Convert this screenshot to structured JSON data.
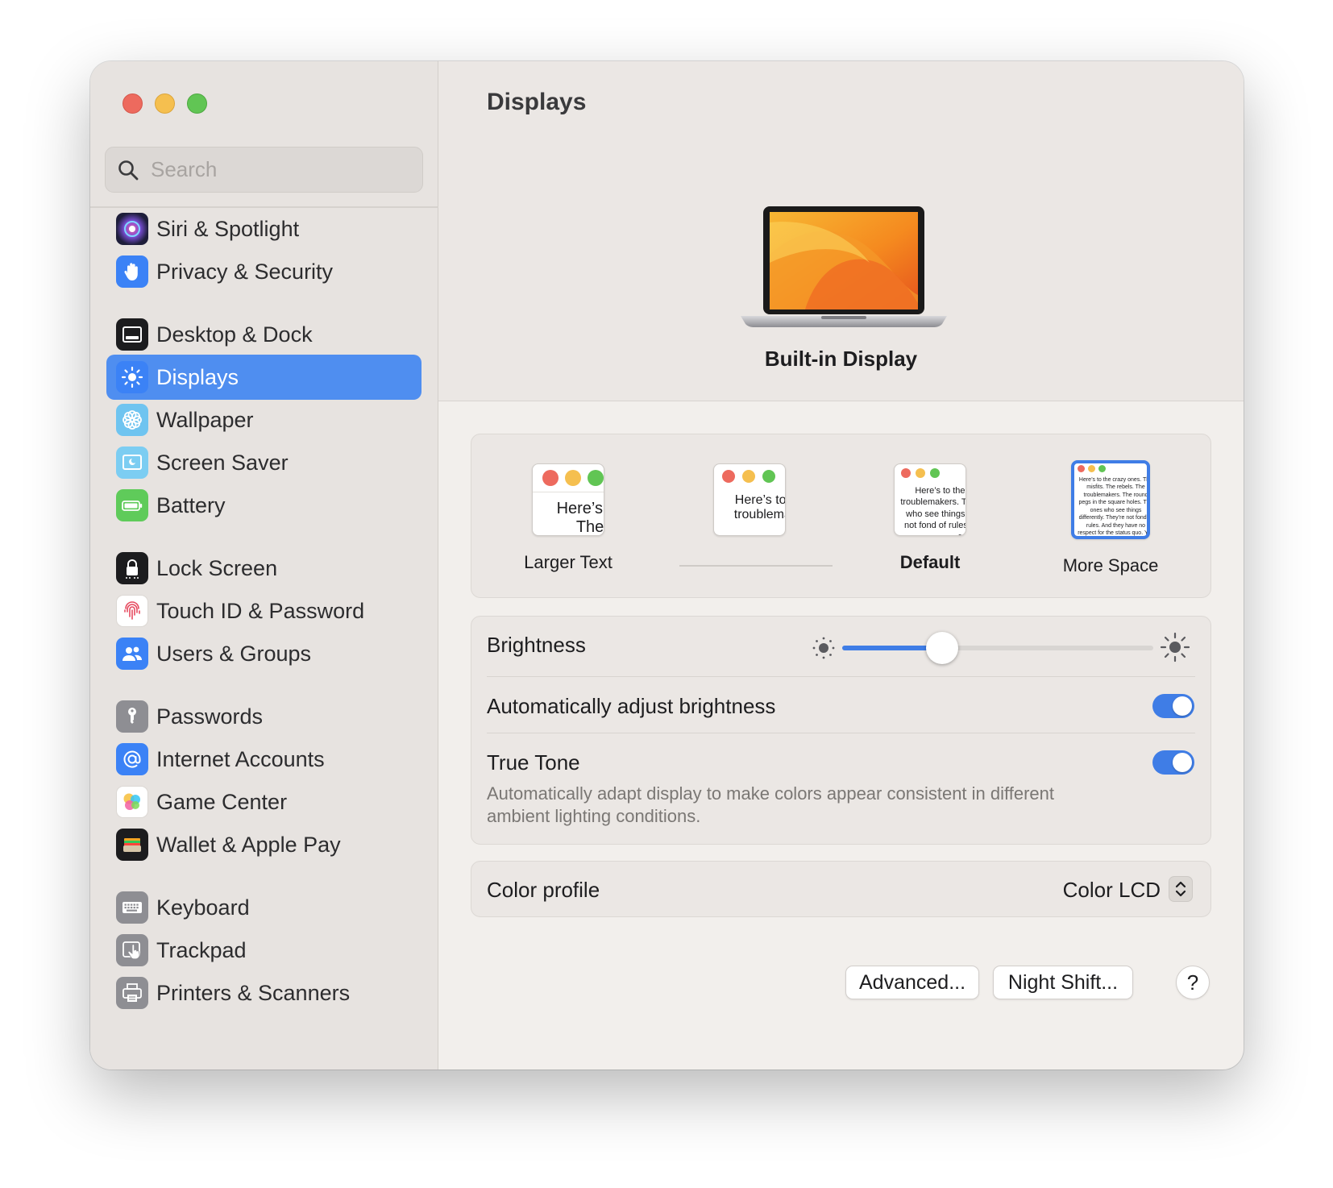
{
  "window": {
    "title": "Displays"
  },
  "sidebar": {
    "search_placeholder": "Search",
    "items": [
      {
        "label": "Siri & Spotlight",
        "icon": "siri-icon",
        "active": false
      },
      {
        "label": "Privacy & Security",
        "icon": "hand-icon",
        "active": false
      },
      {
        "label": "Desktop & Dock",
        "icon": "dock-icon",
        "active": false
      },
      {
        "label": "Displays",
        "icon": "sun-icon",
        "active": true
      },
      {
        "label": "Wallpaper",
        "icon": "flower-icon",
        "active": false
      },
      {
        "label": "Screen Saver",
        "icon": "screensaver-icon",
        "active": false
      },
      {
        "label": "Battery",
        "icon": "battery-icon",
        "active": false
      },
      {
        "label": "Lock Screen",
        "icon": "lock-icon",
        "active": false
      },
      {
        "label": "Touch ID & Password",
        "icon": "fingerprint-icon",
        "active": false
      },
      {
        "label": "Users & Groups",
        "icon": "users-icon",
        "active": false
      },
      {
        "label": "Passwords",
        "icon": "key-icon",
        "active": false
      },
      {
        "label": "Internet Accounts",
        "icon": "at-icon",
        "active": false
      },
      {
        "label": "Game Center",
        "icon": "game-center-icon",
        "active": false
      },
      {
        "label": "Wallet & Apple Pay",
        "icon": "wallet-icon",
        "active": false
      },
      {
        "label": "Keyboard",
        "icon": "keyboard-icon",
        "active": false
      },
      {
        "label": "Trackpad",
        "icon": "trackpad-icon",
        "active": false
      },
      {
        "label": "Printers & Scanners",
        "icon": "printer-icon",
        "active": false
      }
    ]
  },
  "main": {
    "title": "Displays",
    "display_name": "Built-in Display",
    "resolution": {
      "options": [
        {
          "label": "Larger Text",
          "preview": "Here’s to the crazy ones. The troublemakers.",
          "selected": false,
          "bold": false
        },
        {
          "label": "",
          "preview": "Here’s to the crazy ones. The troublemakers. The ones who see things",
          "selected": false,
          "bold": false
        },
        {
          "label": "Default",
          "preview": "Here’s to the crazy ones. The troublemakers. The rebels. The ones who see things differently. They’re not fond of rules. And they have no respect",
          "selected": false,
          "bold": true
        },
        {
          "label": "More Space",
          "preview": "Here’s to the crazy ones. The misfits. The rebels. The troublemakers. The round pegs in the square holes. The ones who see things differently. They’re not fond of rules. And they have no respect for the status quo. You can quote them, disagree with them, glorify or vilify them. About the only thing you can’t do is ignore them. Because they change things.",
          "selected": true,
          "bold": false
        }
      ]
    },
    "brightness": {
      "label": "Brightness",
      "value": 0.32
    },
    "auto_brightness": {
      "label": "Automatically adjust brightness",
      "enabled": true
    },
    "true_tone": {
      "label": "True Tone",
      "description": "Automatically adapt display to make colors appear consistent in different ambient lighting conditions.",
      "enabled": true
    },
    "color_profile": {
      "label": "Color profile",
      "value": "Color LCD"
    },
    "buttons": {
      "advanced": "Advanced...",
      "night_shift": "Night Shift...",
      "help": "?"
    }
  },
  "colors": {
    "accent": "#3f7de6",
    "sidebar_selection": "#4f8ef0",
    "close": "#ed6a5e",
    "minimize": "#f5bf4f",
    "maximize": "#61c554"
  }
}
